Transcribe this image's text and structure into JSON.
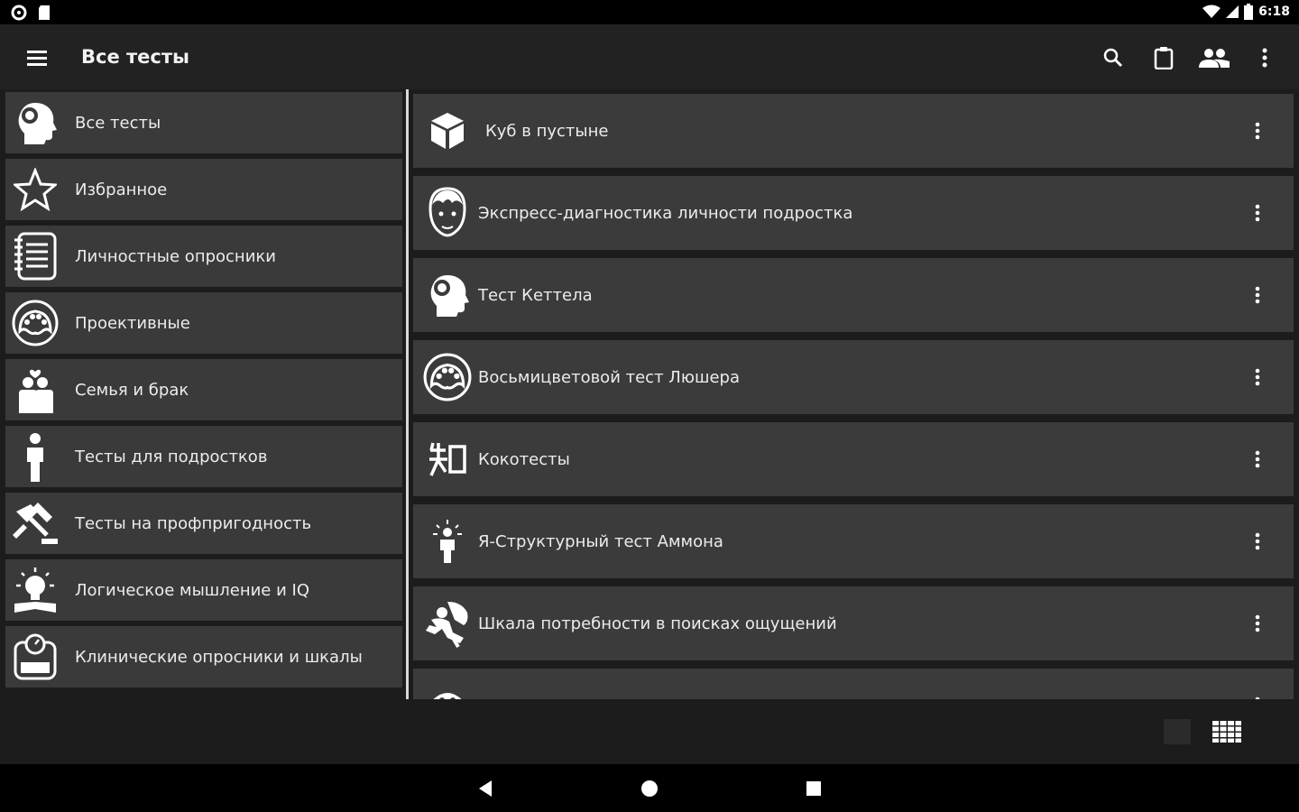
{
  "status_bar": {
    "time": "6:18"
  },
  "toolbar": {
    "title": "Все тесты"
  },
  "sidebar": {
    "items": [
      {
        "label": "Все тесты",
        "icon": "head-gears-icon"
      },
      {
        "label": "Избранное",
        "icon": "star-icon"
      },
      {
        "label": "Личностные опросники",
        "icon": "notebook-icon"
      },
      {
        "label": "Проективные",
        "icon": "palette-icon"
      },
      {
        "label": "Семья и брак",
        "icon": "family-icon"
      },
      {
        "label": "Тесты для подростков",
        "icon": "teen-icon"
      },
      {
        "label": "Тесты на профпригодность",
        "icon": "tools-icon"
      },
      {
        "label": "Логическое мышление и IQ",
        "icon": "lightbulb-icon"
      },
      {
        "label": "Клинические опросники и шкалы",
        "icon": "scale-icon"
      }
    ]
  },
  "tests": {
    "items": [
      {
        "label": "Куб в пустыне",
        "icon": "cube-icon"
      },
      {
        "label": "Экспресс-диагностика личности подростка",
        "icon": "boy-face-icon"
      },
      {
        "label": "Тест Кеттела",
        "icon": "head-gears-icon"
      },
      {
        "label": "Восьмицветовой тест Люшера",
        "icon": "palette-icon"
      },
      {
        "label": "Кокотесты",
        "icon": "kanji-icon"
      },
      {
        "label": "Я-Структурный тест Аммона",
        "icon": "person-sparkle-icon"
      },
      {
        "label": "Шкала потребности в поисках ощущений",
        "icon": "climber-icon"
      },
      {
        "label": "",
        "icon": "partial-icon"
      }
    ]
  },
  "colors": {
    "toolbar": "#222222",
    "item_background": "#3a3a3a",
    "content_background": "#1c1c1c",
    "text": "#ececec"
  }
}
